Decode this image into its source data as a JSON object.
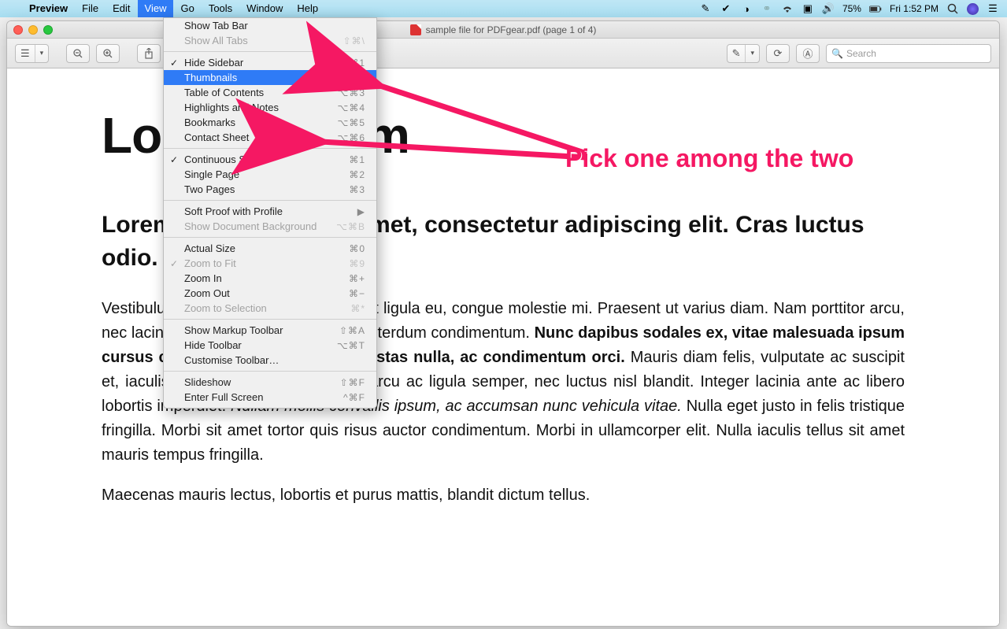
{
  "menubar": {
    "app": "Preview",
    "items": [
      "File",
      "Edit",
      "View",
      "Go",
      "Tools",
      "Window",
      "Help"
    ],
    "active_index": 2,
    "right": {
      "battery": "75%",
      "clock": "Fri 1:52 PM"
    }
  },
  "window": {
    "title": "sample file for PDFgear.pdf (page 1 of 4)",
    "search_placeholder": "Search"
  },
  "dropdown": {
    "groups": [
      [
        {
          "label": "Show Tab Bar",
          "accel": "",
          "disabled": false
        },
        {
          "label": "Show All Tabs",
          "accel": "⇧⌘\\",
          "disabled": true
        }
      ],
      [
        {
          "label": "Hide Sidebar",
          "accel": "⌥⌘1",
          "checked": true
        },
        {
          "label": "Thumbnails",
          "accel": "⌥⌘2",
          "highlight": true
        },
        {
          "label": "Table of Contents",
          "accel": "⌥⌘3"
        },
        {
          "label": "Highlights and Notes",
          "accel": "⌥⌘4"
        },
        {
          "label": "Bookmarks",
          "accel": "⌥⌘5"
        },
        {
          "label": "Contact Sheet",
          "accel": "⌥⌘6"
        }
      ],
      [
        {
          "label": "Continuous Scroll",
          "accel": "⌘1",
          "checked": true
        },
        {
          "label": "Single Page",
          "accel": "⌘2"
        },
        {
          "label": "Two Pages",
          "accel": "⌘3"
        }
      ],
      [
        {
          "label": "Soft Proof with Profile",
          "submenu": true
        },
        {
          "label": "Show Document Background",
          "accel": "⌥⌘B",
          "disabled": true
        }
      ],
      [
        {
          "label": "Actual Size",
          "accel": "⌘0"
        },
        {
          "label": "Zoom to Fit",
          "accel": "⌘9",
          "checked": true,
          "disabled": true
        },
        {
          "label": "Zoom In",
          "accel": "⌘+"
        },
        {
          "label": "Zoom Out",
          "accel": "⌘−"
        },
        {
          "label": "Zoom to Selection",
          "accel": "⌘*",
          "disabled": true
        }
      ],
      [
        {
          "label": "Show Markup Toolbar",
          "accel": "⇧⌘A"
        },
        {
          "label": "Hide Toolbar",
          "accel": "⌥⌘T"
        },
        {
          "label": "Customise Toolbar…",
          "accel": ""
        }
      ],
      [
        {
          "label": "Slideshow",
          "accel": "⇧⌘F"
        },
        {
          "label": "Enter Full Screen",
          "accel": "^⌘F"
        }
      ]
    ]
  },
  "document": {
    "h1": "Lorem ipsum",
    "h2": "Lorem ipsum dolor sit amet, consectetur adipiscing elit. Cras luctus odio.",
    "p1_a": "Vestibulum in risus scelerisque sit amet ligula eu, congue molestie mi. Praesent ut varius diam. Nam porttitor arcu, nec lacinia nisi. Ut ac dolor vitae odio interdum condimentum. ",
    "p1_bold": "Nunc dapibus sodales ex, vitae malesuada ipsum cursus convallis. Maecenas sed egestas nulla, ac condimentum orci.",
    "p1_b": " Mauris diam felis, vulputate ac suscipit et, iaculis non est. Curabitur semper arcu ac ligula semper, nec luctus nisl blandit. Integer lacinia ante ac libero lobortis imperdiet. ",
    "p1_ital": "Nullam mollis convallis ipsum, ac accumsan nunc vehicula vitae.",
    "p1_c": " Nulla eget justo in felis tristique fringilla. Morbi sit amet tortor quis risus auctor condimentum. Morbi in ullamcorper elit. Nulla iaculis tellus sit amet mauris tempus fringilla.",
    "p2": "Maecenas mauris lectus, lobortis et purus mattis, blandit dictum tellus."
  },
  "annotation": {
    "text": "Pick one among the two"
  }
}
